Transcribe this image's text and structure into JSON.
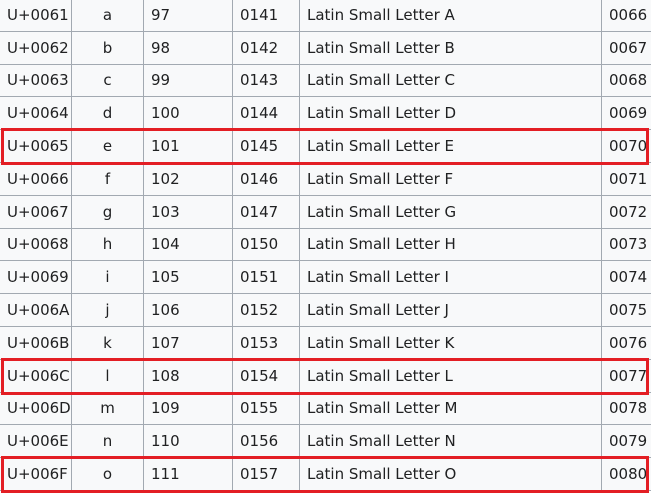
{
  "table": {
    "rows": [
      [
        "U+0061",
        "a",
        "97",
        "0141",
        "Latin Small Letter A",
        "0066"
      ],
      [
        "U+0062",
        "b",
        "98",
        "0142",
        "Latin Small Letter B",
        "0067"
      ],
      [
        "U+0063",
        "c",
        "99",
        "0143",
        "Latin Small Letter C",
        "0068"
      ],
      [
        "U+0064",
        "d",
        "100",
        "0144",
        "Latin Small Letter D",
        "0069"
      ],
      [
        "U+0065",
        "e",
        "101",
        "0145",
        "Latin Small Letter E",
        "0070"
      ],
      [
        "U+0066",
        "f",
        "102",
        "0146",
        "Latin Small Letter F",
        "0071"
      ],
      [
        "U+0067",
        "g",
        "103",
        "0147",
        "Latin Small Letter G",
        "0072"
      ],
      [
        "U+0068",
        "h",
        "104",
        "0150",
        "Latin Small Letter H",
        "0073"
      ],
      [
        "U+0069",
        "i",
        "105",
        "0151",
        "Latin Small Letter I",
        "0074"
      ],
      [
        "U+006A",
        "j",
        "106",
        "0152",
        "Latin Small Letter J",
        "0075"
      ],
      [
        "U+006B",
        "k",
        "107",
        "0153",
        "Latin Small Letter K",
        "0076"
      ],
      [
        "U+006C",
        "l",
        "108",
        "0154",
        "Latin Small Letter L",
        "0077"
      ],
      [
        "U+006D",
        "m",
        "109",
        "0155",
        "Latin Small Letter M",
        "0078"
      ],
      [
        "U+006E",
        "n",
        "110",
        "0156",
        "Latin Small Letter N",
        "0079"
      ],
      [
        "U+006F",
        "o",
        "111",
        "0157",
        "Latin Small Letter O",
        "0080"
      ]
    ],
    "highlighted_rows": [
      4,
      11,
      14
    ]
  },
  "colors": {
    "highlight": "#e31e24",
    "grid_line": "#a2a9b1",
    "row_background": "#f8f9fa",
    "text": "#202122"
  }
}
